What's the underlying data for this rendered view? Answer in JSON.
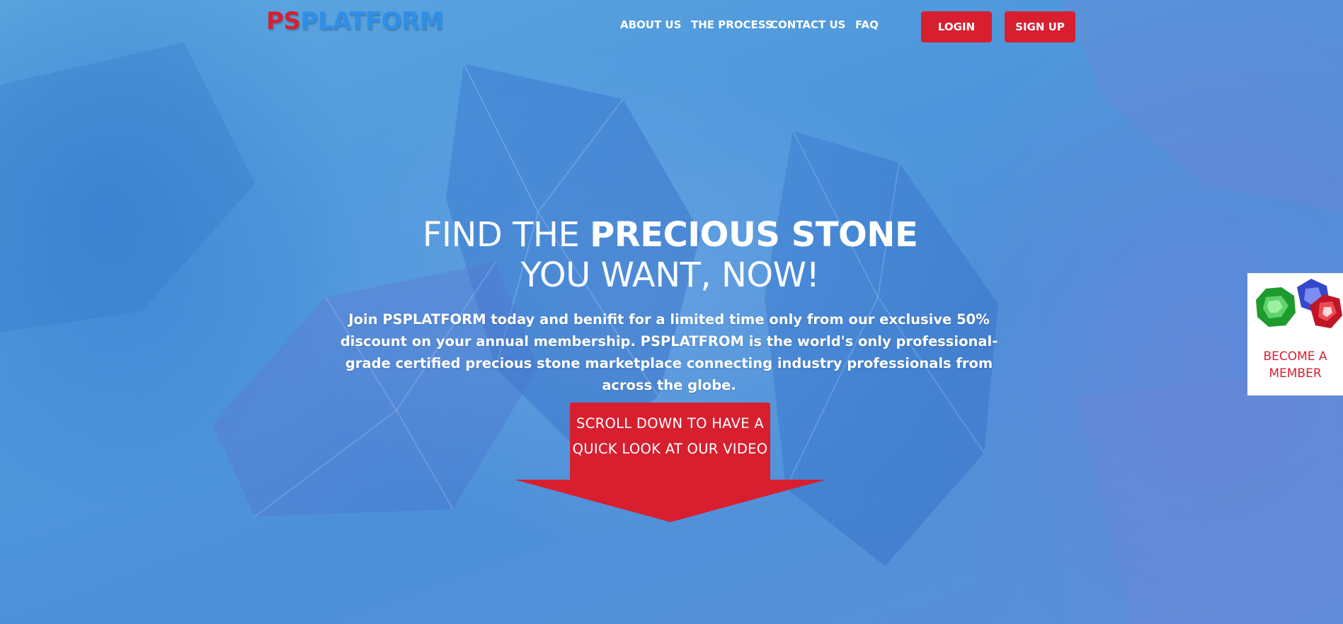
{
  "header": {
    "logo_ps": "PS",
    "logo_platform": "PLATFORM",
    "nav": [
      {
        "label": "ABOUT US"
      },
      {
        "label": "THE PROCESS"
      },
      {
        "label": "CONTACT US"
      },
      {
        "label": "FAQ"
      }
    ],
    "login_label": "LOGIN",
    "signup_label": "SIGN UP"
  },
  "hero": {
    "title_line1_light": "FIND THE ",
    "title_line1_bold": "PRECIOUS STONE",
    "title_line2": "YOU WANT, NOW!",
    "description": "Join PSPLATFORM today and benifit for a limited time only from our exclusive 50% discount on your annual membership. PSPLATFROM is the world's only professional-grade certified precious stone marketplace connecting industry professionals from across the globe.",
    "scroll_cta": "SCROLL DOWN TO HAVE A QUICK LOOK AT OUR VIDEO"
  },
  "side_widget": {
    "label": "BECOME A MEMBER"
  },
  "colors": {
    "accent_red": "#d71f30",
    "logo_blue": "#2f8fe6",
    "background_blue": "#4f98dc"
  }
}
